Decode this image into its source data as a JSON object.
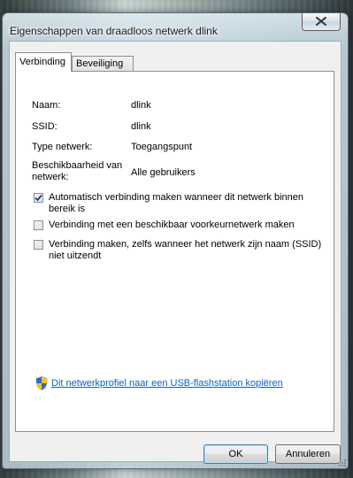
{
  "window": {
    "title": "Eigenschappen van draadloos netwerk dlink"
  },
  "tabs": [
    {
      "label": "Verbinding",
      "active": true
    },
    {
      "label": "Beveiliging",
      "active": false
    }
  ],
  "properties": [
    {
      "label": "Naam:",
      "value": "dlink"
    },
    {
      "label": "SSID:",
      "value": "dlink"
    },
    {
      "label": "Type netwerk:",
      "value": "Toegangspunt"
    },
    {
      "label": "Beschikbaarheid van netwerk:",
      "value": "Alle gebruikers"
    }
  ],
  "options": [
    {
      "label": "Automatisch verbinding maken wanneer dit netwerk binnen bereik is",
      "checked": true
    },
    {
      "label": "Verbinding met een beschikbaar voorkeurnetwerk maken",
      "checked": false
    },
    {
      "label": "Verbinding maken, zelfs wanneer het netwerk zijn naam (SSID) niet uitzendt",
      "checked": false
    }
  ],
  "link": {
    "label": "Dit netwerkprofiel naar een USB-flashstation kopiëren",
    "icon": "uac-shield-icon"
  },
  "buttons": {
    "ok": "OK",
    "cancel": "Annuleren"
  },
  "colors": {
    "link": "#0066cc",
    "check": "#1c3f94"
  }
}
